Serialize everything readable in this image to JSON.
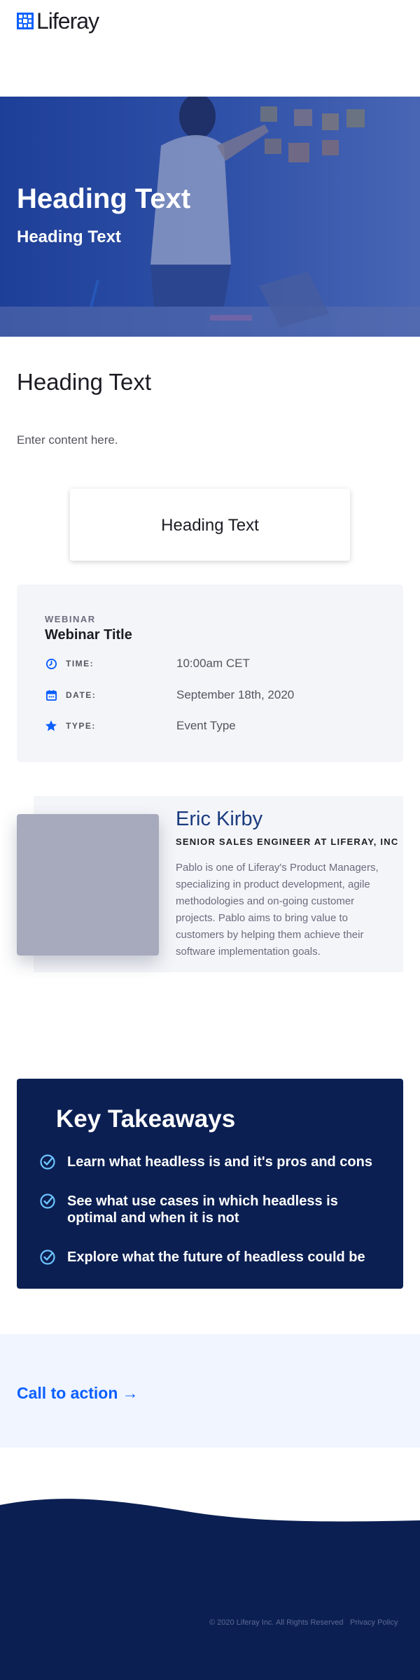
{
  "header": {
    "logo_text": "Liferay"
  },
  "hero": {
    "title": "Heading Text",
    "subtitle": "Heading Text"
  },
  "main": {
    "heading": "Heading Text",
    "content": "Enter content here."
  },
  "card": {
    "title": "Heading Text"
  },
  "webinar": {
    "kicker": "WEBINAR",
    "title": "Webinar Title",
    "rows": [
      {
        "icon": "clock-icon",
        "label": "TIME:",
        "value": "10:00am CET"
      },
      {
        "icon": "calendar-icon",
        "label": "DATE:",
        "value": "September 18th, 2020"
      },
      {
        "icon": "star-icon",
        "label": "TYPE:",
        "value": "Event Type"
      }
    ]
  },
  "speaker": {
    "name": "Eric Kirby",
    "role": "SENIOR SALES ENGINEER AT LIFERAY, INC",
    "bio": "Pablo is one of Liferay's Product Managers, specializing in product development, agile methodologies and on-going customer projects. Pablo aims to bring value to customers by helping them achieve their software implementation goals."
  },
  "takeaways": {
    "title": "Key Takeaways",
    "items": [
      "Learn what headless is and it's pros and cons",
      "See what use cases in which headless is optimal and when it is not",
      "Explore what the future of headless could be"
    ]
  },
  "cta": {
    "label": "Call to action →"
  },
  "footer": {
    "copyright": "© 2020 Liferay Inc. All Rights Reserved",
    "privacy": "Privacy Policy"
  },
  "colors": {
    "brand_blue": "#0b5fff",
    "navy": "#0b1f52",
    "light_panel": "#f4f5f9",
    "cta_band": "#f0f5ff"
  }
}
